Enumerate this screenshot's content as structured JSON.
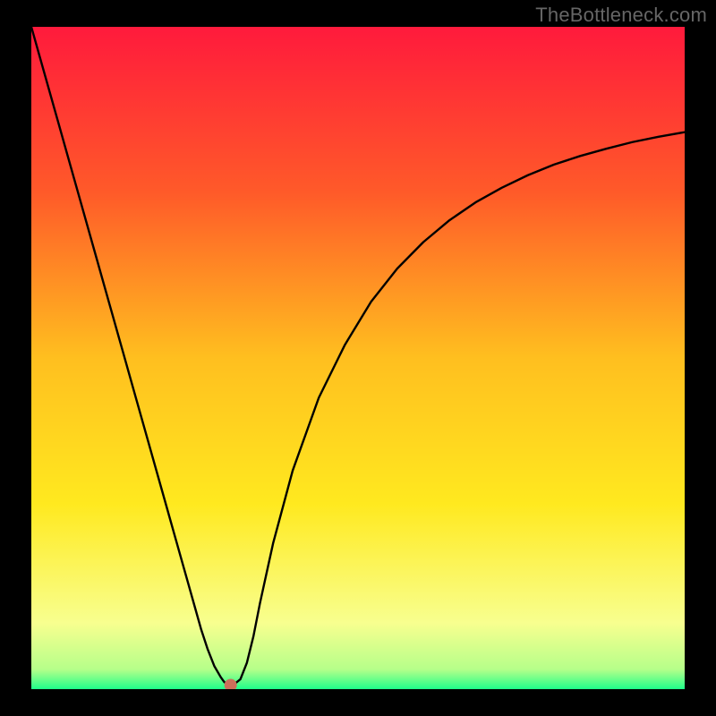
{
  "watermark": "TheBottleneck.com",
  "chart_data": {
    "type": "line",
    "title": "",
    "xlabel": "",
    "ylabel": "",
    "xlim": [
      0,
      100
    ],
    "ylim": [
      0,
      100
    ],
    "grid": false,
    "legend": false,
    "background": {
      "type": "vertical-gradient",
      "stops": [
        {
          "pos": 0.0,
          "color": "#ff1a3c"
        },
        {
          "pos": 0.25,
          "color": "#ff5a29"
        },
        {
          "pos": 0.5,
          "color": "#ffbf1f"
        },
        {
          "pos": 0.72,
          "color": "#ffe91f"
        },
        {
          "pos": 0.9,
          "color": "#f8ff8f"
        },
        {
          "pos": 0.97,
          "color": "#b6ff8a"
        },
        {
          "pos": 1.0,
          "color": "#1fff8a"
        }
      ]
    },
    "series": [
      {
        "name": "curve",
        "color": "#000000",
        "x": [
          0,
          2,
          4,
          6,
          8,
          10,
          12,
          14,
          16,
          18,
          20,
          22,
          24,
          25,
          26,
          27,
          28,
          29,
          29.5,
          30,
          30.5,
          31,
          32,
          33,
          34,
          35,
          37,
          40,
          44,
          48,
          52,
          56,
          60,
          64,
          68,
          72,
          76,
          80,
          84,
          88,
          92,
          96,
          100
        ],
        "y": [
          100,
          93,
          86,
          79,
          72,
          65,
          58,
          51,
          44,
          37,
          30,
          23,
          16,
          12.5,
          9,
          6,
          3.5,
          1.8,
          1.1,
          0.7,
          0.6,
          0.7,
          1.5,
          4,
          8,
          13,
          22,
          33,
          44,
          52,
          58.5,
          63.5,
          67.5,
          70.8,
          73.5,
          75.7,
          77.6,
          79.2,
          80.5,
          81.6,
          82.6,
          83.4,
          84.1
        ]
      }
    ],
    "markers": [
      {
        "name": "min-point",
        "x": 30.5,
        "y": 0.6,
        "color": "#cc6f5a",
        "r": 7
      }
    ]
  }
}
